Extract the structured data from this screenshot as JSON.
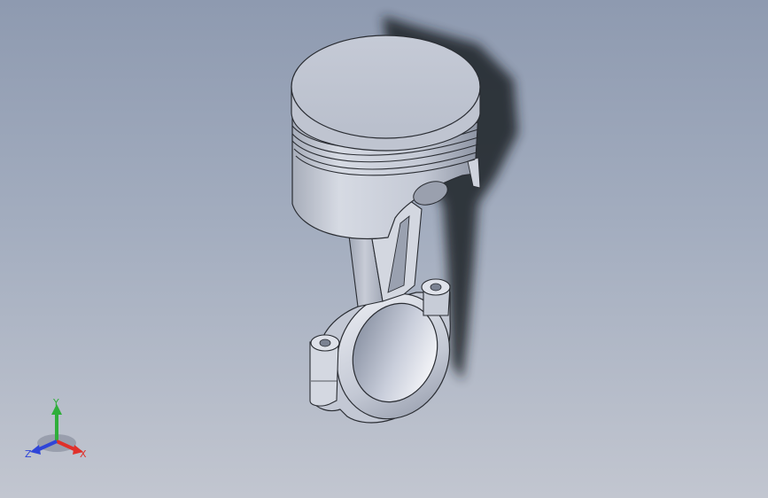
{
  "viewport": {
    "background_top": "#8e9ab0",
    "background_bottom": "#c2c6d0"
  },
  "model": {
    "name": "piston-connecting-rod-assembly",
    "part_color": "#c9cedb",
    "shadow_color": "#1e2126"
  },
  "triad": {
    "x_label": "X",
    "y_label": "Y",
    "z_label": "Z",
    "x_color": "#e0302a",
    "y_color": "#2fae3a",
    "z_color": "#2f45d8"
  }
}
